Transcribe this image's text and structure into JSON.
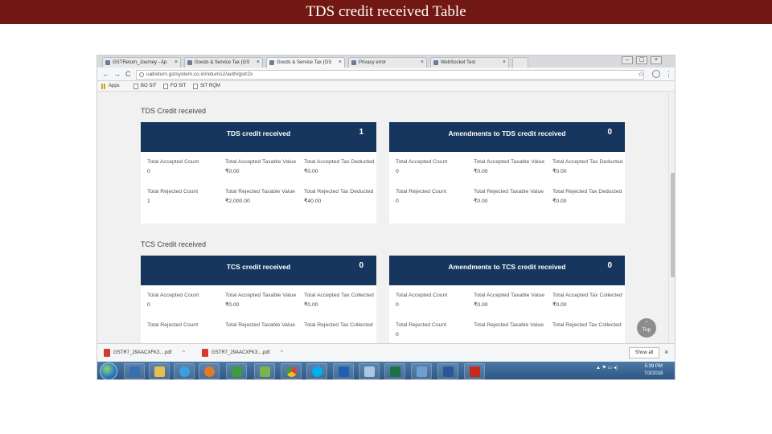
{
  "slide": {
    "title": "TDS  credit received Table"
  },
  "browser": {
    "tabs": [
      {
        "label": "GSTReturn_Journey - Ap",
        "active": false
      },
      {
        "label": "Goods & Service Tax (GS",
        "active": false
      },
      {
        "label": "Goods & Service Tax (GS",
        "active": true
      },
      {
        "label": "Privacy error",
        "active": false
      },
      {
        "label": "WebSocket Test",
        "active": false
      }
    ],
    "tab_close": "×",
    "window_controls": [
      "–",
      "▢",
      "×"
    ],
    "nav": {
      "back": "←",
      "forward": "→",
      "reload": "C"
    },
    "url": "uatreturn.gstsystem.co.in/returns2/auth/gstr2x",
    "star": "☆",
    "menu": "⋮",
    "bookmarks": [
      "Apps",
      "BO SIT",
      "FO SIT",
      "SIT RQM"
    ]
  },
  "page": {
    "tds_section_title": "TDS Credit received",
    "tcs_section_title": "TCS Credit received",
    "tds_card": {
      "title": "TDS credit received",
      "count": "1",
      "accepted_count_label": "Total Accepted Count",
      "accepted_count": "0",
      "accepted_value_label": "Total Accepted Taxable Value",
      "accepted_value": "₹0.00",
      "accepted_tax_label": "Total Accepted Tax Deducted",
      "accepted_tax": "₹0.00",
      "rejected_count_label": "Total Rejected Count",
      "rejected_count": "1",
      "rejected_value_label": "Total Rejected Taxable Value",
      "rejected_value": "₹2,000.00",
      "rejected_tax_label": "Total Rejected Tax Deducted",
      "rejected_tax": "₹40.00"
    },
    "tds_amend_card": {
      "title": "Amendments to TDS credit received",
      "count": "0",
      "accepted_count_label": "Total Accepted Count",
      "accepted_count": "0",
      "accepted_value_label": "Total Accepted Taxable Value",
      "accepted_value": "₹0.00",
      "accepted_tax_label": "Total Accepted Tax Deducted",
      "accepted_tax": "₹0.00",
      "rejected_count_label": "Total Rejected Count",
      "rejected_count": "0",
      "rejected_value_label": "Total Rejected Taxable Value",
      "rejected_value": "₹0.00",
      "rejected_tax_label": "Total Rejected Tax Deducted",
      "rejected_tax": "₹0.00"
    },
    "tcs_card": {
      "title": "TCS credit received",
      "count": "0",
      "accepted_count_label": "Total Accepted Count",
      "accepted_count": "0",
      "accepted_value_label": "Total Accepted Taxable Value",
      "accepted_value": "₹0.00",
      "accepted_tax_label": "Total Accepted Tax Collected",
      "accepted_tax": "₹0.00",
      "rejected_count_label": "Total Rejected Count",
      "rejected_value_label": "Total Rejected Taxable Value",
      "rejected_tax_label": "Total Rejected Tax Collected"
    },
    "tcs_amend_card": {
      "title": "Amendments to TCS credit received",
      "count": "0",
      "accepted_count_label": "Total Accepted Count",
      "accepted_count": "0",
      "accepted_value_label": "Total Accepted Taxable Value",
      "accepted_value": "₹0.00",
      "accepted_tax_label": "Total Accepted Tax Collected",
      "accepted_tax": "₹0.00",
      "rejected_count_label": "Total Rejected Count",
      "rejected_count": "0",
      "rejected_value_label": "Total Rejected Taxable Value",
      "rejected_tax_label": "Total Rejected Tax Collected"
    },
    "top_button": "Top",
    "top_arrow": "⌃"
  },
  "downloads": {
    "items": [
      "GSTR7_29AACXFK3....pdf",
      "GSTR7_29AACXFK3....pdf"
    ],
    "chevron": "^",
    "show_all": "Show all",
    "close": "×"
  },
  "taskbar": {
    "tray_icons": "▲ ⚑ ▭ ◂)",
    "time": "5:39 PM",
    "date": "7/3/2018"
  },
  "colors": {
    "slide_header": "#721812",
    "card_header": "#17365d",
    "taskbar": "#2a5382"
  }
}
